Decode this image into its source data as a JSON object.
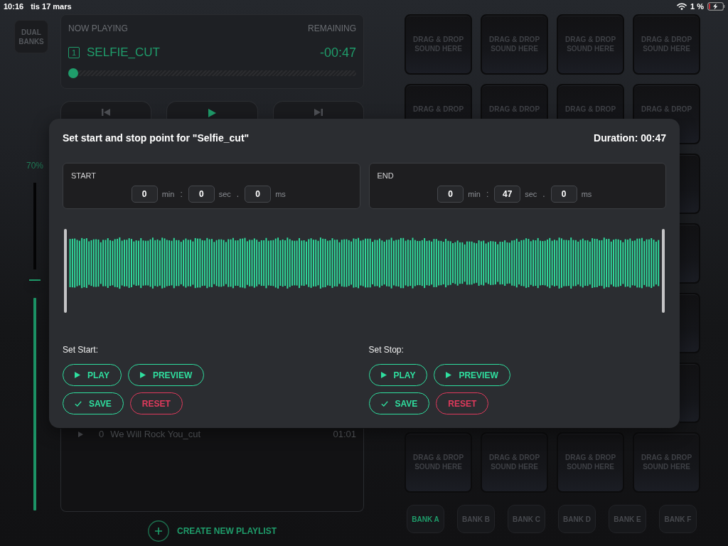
{
  "status_bar": {
    "time": "10:16",
    "date": "tis 17 mars",
    "battery": "1 %"
  },
  "sidebar": {
    "dual_banks": "DUAL BANKS",
    "volume": {
      "reading": "70%",
      "level": 0.7
    }
  },
  "now_playing": {
    "label": "NOW PLAYING",
    "remaining_label": "REMAINING",
    "track_number": "1",
    "title": "SELFIE_CUT",
    "remaining": "-00:47",
    "level": 0
  },
  "transport": [
    {
      "kind": "previous"
    },
    {
      "kind": "play"
    },
    {
      "kind": "next"
    }
  ],
  "playlist": {
    "rows": [
      {
        "number": "0",
        "title": "We Will Rock You_cut",
        "duration": "01:01"
      }
    ],
    "create_button": "CREATE NEW PLAYLIST"
  },
  "pad_rows": [
    {
      "pads": [
        {
          "label": "DRAG & DROP SOUND HERE"
        },
        {
          "label": "DRAG & DROP SOUND HERE"
        },
        {
          "label": "DRAG & DROP SOUND HERE"
        },
        {
          "label": "DRAG & DROP SOUND HERE"
        }
      ]
    },
    {
      "pads": [
        {
          "label": "DRAG & DROP"
        },
        {
          "label": "DRAG & DROP"
        },
        {
          "label": "DRAG & DROP"
        },
        {
          "label": "DRAG & DROP"
        }
      ]
    },
    {
      "covered_by_dialog": true
    },
    {
      "covered_by_dialog": true
    },
    {
      "covered_by_dialog": true
    },
    {
      "covered_by_dialog": true
    },
    {
      "pads": [
        {
          "label": "DRAG & DROP SOUND HERE"
        },
        {
          "label": "DRAG & DROP SOUND HERE"
        },
        {
          "label": "DRAG & DROP SOUND HERE"
        },
        {
          "label": "DRAG & DROP SOUND HERE"
        }
      ]
    }
  ],
  "banks": [
    {
      "label": "BANK A",
      "selected": true
    },
    {
      "label": "BANK B",
      "selected": false
    },
    {
      "label": "BANK C",
      "selected": false
    },
    {
      "label": "BANK D",
      "selected": false
    },
    {
      "label": "BANK E",
      "selected": false
    },
    {
      "label": "BANK F",
      "selected": false
    }
  ],
  "dialog": {
    "title": "Set start and stop point for \"Selfie_cut\"",
    "duration": "Duration: 00:47",
    "points": [
      {
        "label": "START",
        "fields": [
          {
            "value": "0",
            "unit": "min",
            "separator": ":"
          },
          {
            "value": "0",
            "unit": "sec",
            "separator": "."
          },
          {
            "value": "0",
            "unit": "ms"
          }
        ]
      },
      {
        "label": "END",
        "fields": [
          {
            "value": "0",
            "unit": "min",
            "separator": ":"
          },
          {
            "value": "47",
            "unit": "sec",
            "separator": "."
          },
          {
            "value": "0",
            "unit": "ms"
          }
        ]
      }
    ],
    "sections": [
      {
        "label": "Set Start:",
        "button_rows": [
          [
            {
              "kind": "play",
              "label": "PLAY"
            },
            {
              "kind": "preview",
              "label": "PREVIEW"
            }
          ],
          [
            {
              "kind": "save",
              "label": "SAVE"
            },
            {
              "kind": "reset",
              "label": "RESET"
            }
          ]
        ]
      },
      {
        "label": "Set Stop:",
        "button_rows": [
          [
            {
              "kind": "play",
              "label": "PLAY"
            },
            {
              "kind": "preview",
              "label": "PREVIEW"
            }
          ],
          [
            {
              "kind": "save",
              "label": "SAVE"
            },
            {
              "kind": "reset",
              "label": "RESET"
            }
          ]
        ]
      }
    ]
  }
}
